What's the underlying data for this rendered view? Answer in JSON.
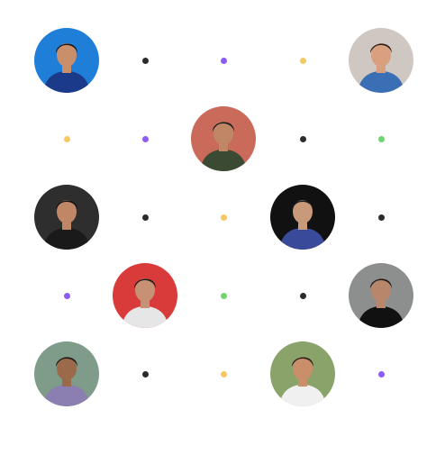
{
  "colors": {
    "dark": "#2b2b2b",
    "purple": "#8b5cf6",
    "yellow": "#f5c862",
    "green": "#6fd46f"
  },
  "grid": {
    "rows": [
      [
        {
          "kind": "avatar",
          "bg": "#1f7fd8",
          "shirt": "#1c3a8a",
          "skin": "#c98f6b",
          "hair": "#1a1a1a"
        },
        {
          "kind": "dot",
          "color": "dark"
        },
        {
          "kind": "dot",
          "color": "purple"
        },
        {
          "kind": "dot",
          "color": "yellow"
        },
        {
          "kind": "avatar",
          "bg": "#cfc7c2",
          "shirt": "#3a6fb5",
          "skin": "#d9a07f",
          "hair": "#2a1e1a"
        }
      ],
      [
        {
          "kind": "dot",
          "color": "yellow"
        },
        {
          "kind": "dot",
          "color": "purple"
        },
        {
          "kind": "avatar",
          "bg": "#c96a5a",
          "shirt": "#3b4a32",
          "skin": "#c08767",
          "hair": "#1a1a1a"
        },
        {
          "kind": "dot",
          "color": "dark"
        },
        {
          "kind": "dot",
          "color": "green"
        }
      ],
      [
        {
          "kind": "avatar",
          "bg": "#2e2e2e",
          "shirt": "#1a1a1a",
          "skin": "#c08767",
          "hair": "#141414"
        },
        {
          "kind": "dot",
          "color": "dark"
        },
        {
          "kind": "dot",
          "color": "yellow"
        },
        {
          "kind": "avatar",
          "bg": "#111111",
          "shirt": "#3a4a9a",
          "skin": "#c99a7a",
          "hair": "#1a1a1a"
        },
        {
          "kind": "dot",
          "color": "dark"
        }
      ],
      [
        {
          "kind": "dot",
          "color": "purple"
        },
        {
          "kind": "avatar",
          "bg": "#d93b3b",
          "shirt": "#e6e6e6",
          "skin": "#c79175",
          "hair": "#1a1a1a"
        },
        {
          "kind": "dot",
          "color": "green"
        },
        {
          "kind": "dot",
          "color": "dark"
        },
        {
          "kind": "avatar",
          "bg": "#8d8f8f",
          "shirt": "#111111",
          "skin": "#b8866a",
          "hair": "#1a1a1a"
        }
      ],
      [
        {
          "kind": "avatar",
          "bg": "#7f9b8a",
          "shirt": "#8a7fb0",
          "skin": "#9a6a4a",
          "hair": "#1a1a1a"
        },
        {
          "kind": "dot",
          "color": "dark"
        },
        {
          "kind": "dot",
          "color": "yellow"
        },
        {
          "kind": "avatar",
          "bg": "#8aa36a",
          "shirt": "#f0f0f0",
          "skin": "#c98f6b",
          "hair": "#2a1e1a"
        },
        {
          "kind": "dot",
          "color": "purple"
        }
      ]
    ]
  }
}
